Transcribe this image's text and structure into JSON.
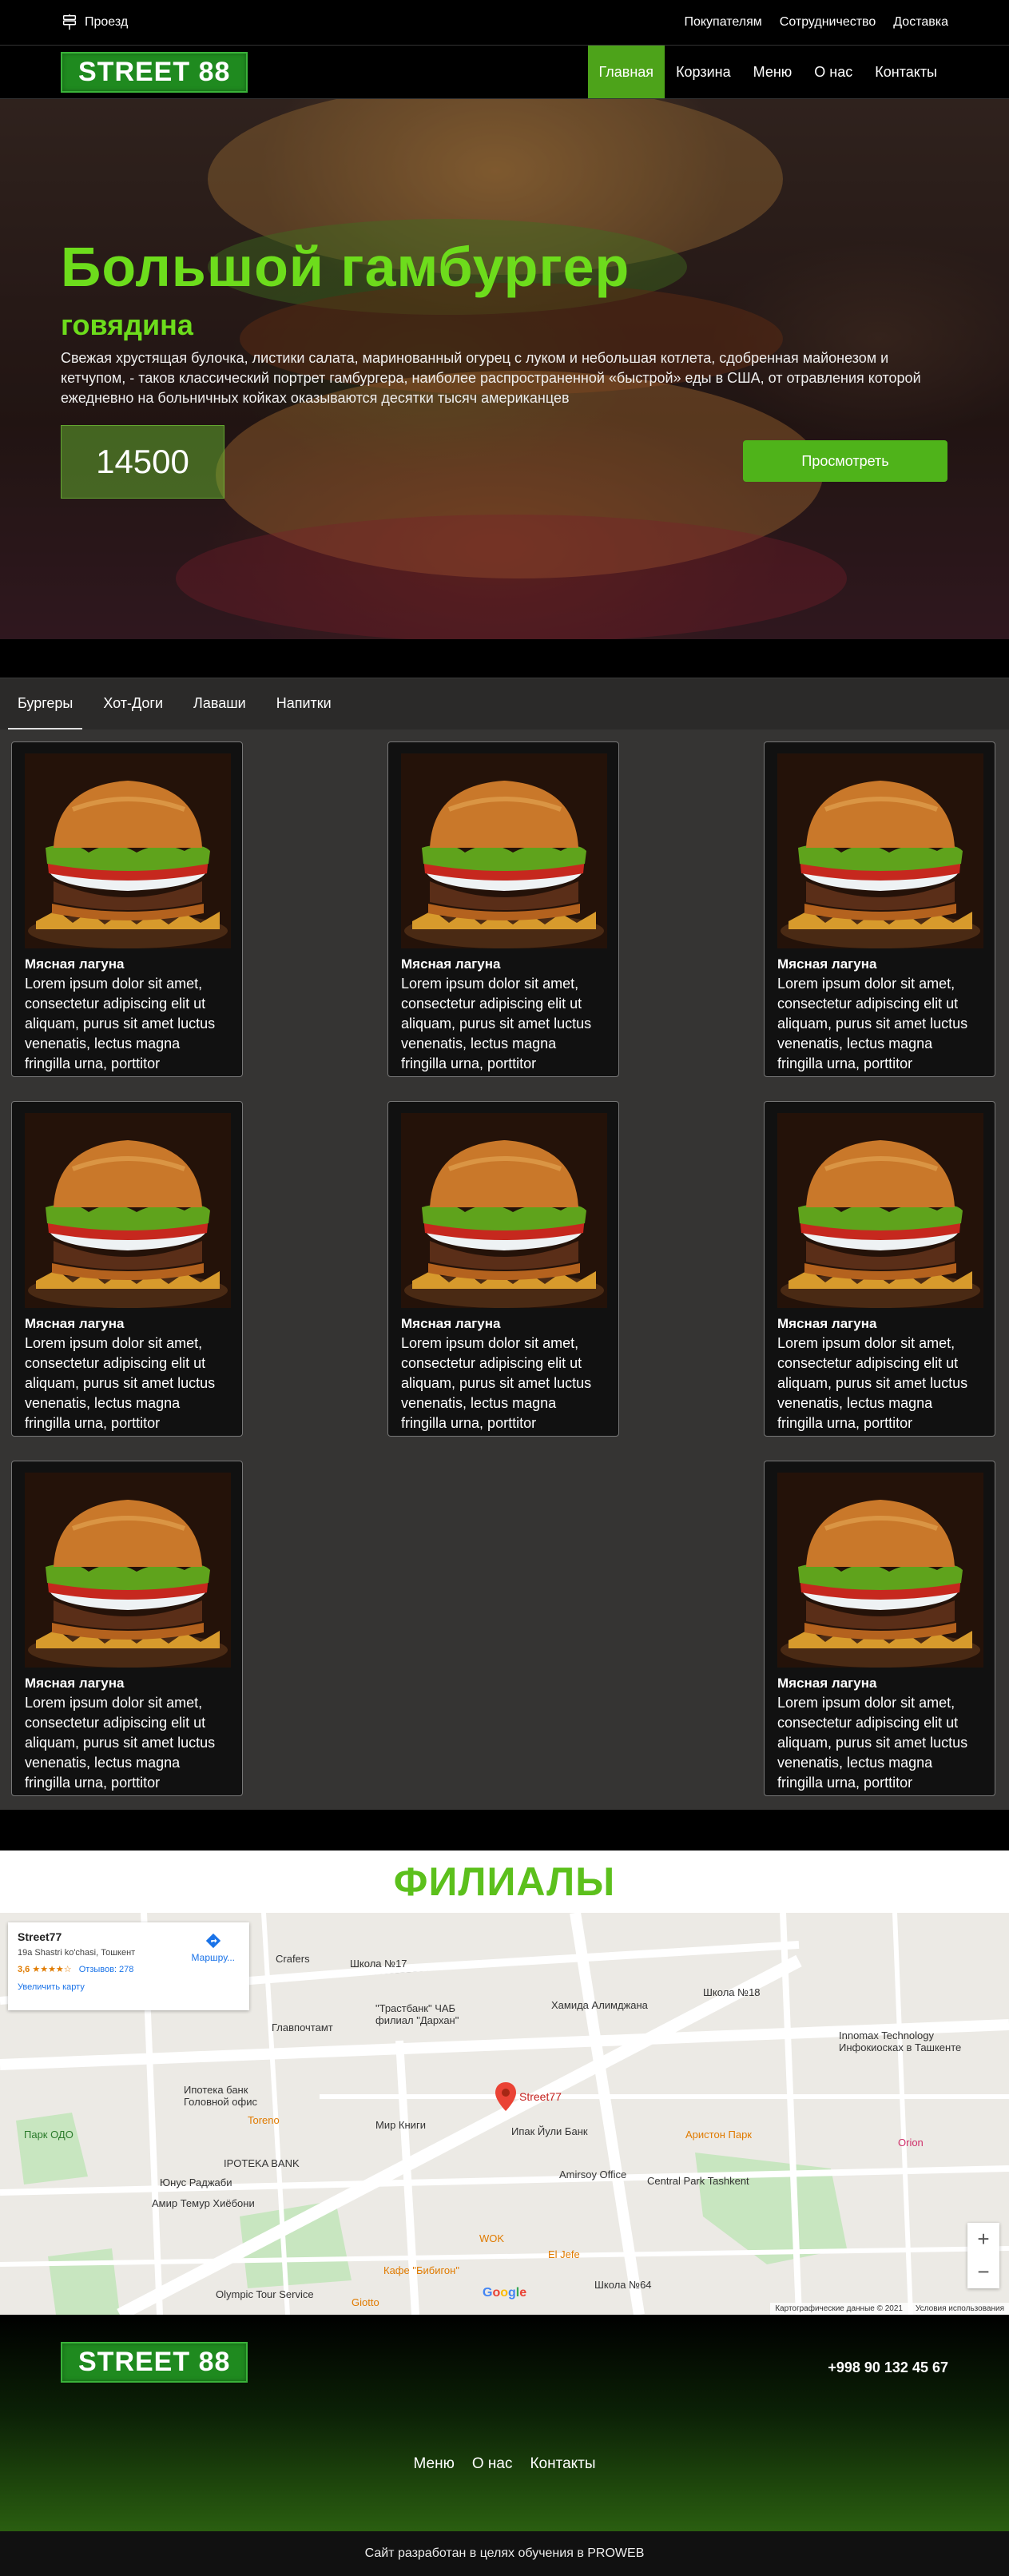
{
  "topbar": {
    "location_label": "Проезд",
    "links": [
      "Покупателям",
      "Сотрудничество",
      "Доставка"
    ]
  },
  "brand": {
    "logo": "STREET 88"
  },
  "nav": {
    "items": [
      "Главная",
      "Корзина",
      "Меню",
      "О нас",
      "Контакты"
    ],
    "active": "Главная"
  },
  "hero": {
    "title": "Большой гамбургер",
    "subtitle": "говядина",
    "description": "Свежая хрустящая булочка, листики салата, маринованный огурец с луком и небольшая котлета, сдобренная майонезом и кетчупом, - таков классический портрет гамбургера, наиболее распространенной «быстрой» еды в США, от отравления которой ежедневно на больничных койках оказываются десятки тысяч американцев",
    "price": "14500",
    "view_button": "Просмотреть"
  },
  "tabs": [
    "Бургеры",
    "Хот-Доги",
    "Лаваши",
    "Напитки"
  ],
  "products": [
    {
      "name": "Мясная лагуна",
      "description": "Lorem ipsum dolor sit amet, consectetur adipiscing elit ut aliquam, purus sit amet luctus venenatis, lectus magna fringilla urna, porttitor"
    },
    {
      "name": "Мясная лагуна",
      "description": "Lorem ipsum dolor sit amet, consectetur adipiscing elit ut aliquam, purus sit amet luctus venenatis, lectus magna fringilla urna, porttitor"
    },
    {
      "name": "Мясная лагуна",
      "description": "Lorem ipsum dolor sit amet, consectetur adipiscing elit ut aliquam, purus sit amet luctus venenatis, lectus magna fringilla urna, porttitor"
    },
    {
      "name": "Мясная лагуна",
      "description": "Lorem ipsum dolor sit amet, consectetur adipiscing elit ut aliquam, purus sit amet luctus venenatis, lectus magna fringilla urna, porttitor"
    },
    {
      "name": "Мясная лагуна",
      "description": "Lorem ipsum dolor sit amet, consectetur adipiscing elit ut aliquam, purus sit amet luctus venenatis, lectus magna fringilla urna, porttitor"
    },
    {
      "name": "Мясная лагуна",
      "description": "Lorem ipsum dolor sit amet, consectetur adipiscing elit ut aliquam, purus sit amet luctus venenatis, lectus magna fringilla urna, porttitor"
    },
    {
      "name": "Мясная лагуна",
      "description": "Lorem ipsum dolor sit amet, consectetur adipiscing elit ut aliquam, purus sit amet luctus venenatis, lectus magna fringilla urna, porttitor"
    },
    {
      "name": "Мясная лагуна",
      "description": "Lorem ipsum dolor sit amet, consectetur adipiscing elit ut aliquam, purus sit amet luctus venenatis, lectus magna fringilla urna, porttitor"
    }
  ],
  "branches": {
    "title": "ФИЛИАЛЫ",
    "map_card": {
      "name": "Street77",
      "address": "19a Shastri ko'chasi, Тошкент",
      "rating": "3,6",
      "reviews": "Отзывов: 278",
      "enlarge": "Увеличить карту",
      "directions": "Маршру..."
    },
    "marker_label": "Street77",
    "labels": [
      "Crafers",
      "Школа №17",
      "\"Трастбанк\" ЧАБ филиал \"Дархан\"",
      "Хамида Алимджана",
      "Школа №18",
      "Главпочтамт",
      "Ипотека банк Головной офис",
      "Мир Книги",
      "Ипак Йули Банк",
      "IPOTEKA BANK",
      "Юнус Раджаби",
      "Амир Темур Хиёбони",
      "Amirsoy Office",
      "Central Park Tashkent",
      "Аристон Парк",
      "Orion",
      "Парк ОДО",
      "Toreno",
      "WOK",
      "El Jefe",
      "Кафе \"Бибигон\"",
      "Olympic Tour Service",
      "Школа №64",
      "Giotto",
      "Innomax Technology Инфокиосках в Ташкенте"
    ],
    "map_footer": [
      "Картографические данные © 2021",
      "Условия использования"
    ]
  },
  "footer": {
    "logo": "STREET 88",
    "phone": "+998 90 132 45 67",
    "links": [
      "Меню",
      "О нас",
      "Контакты"
    ],
    "credit": "Сайт разработан в целях обучения в PROWEB"
  }
}
